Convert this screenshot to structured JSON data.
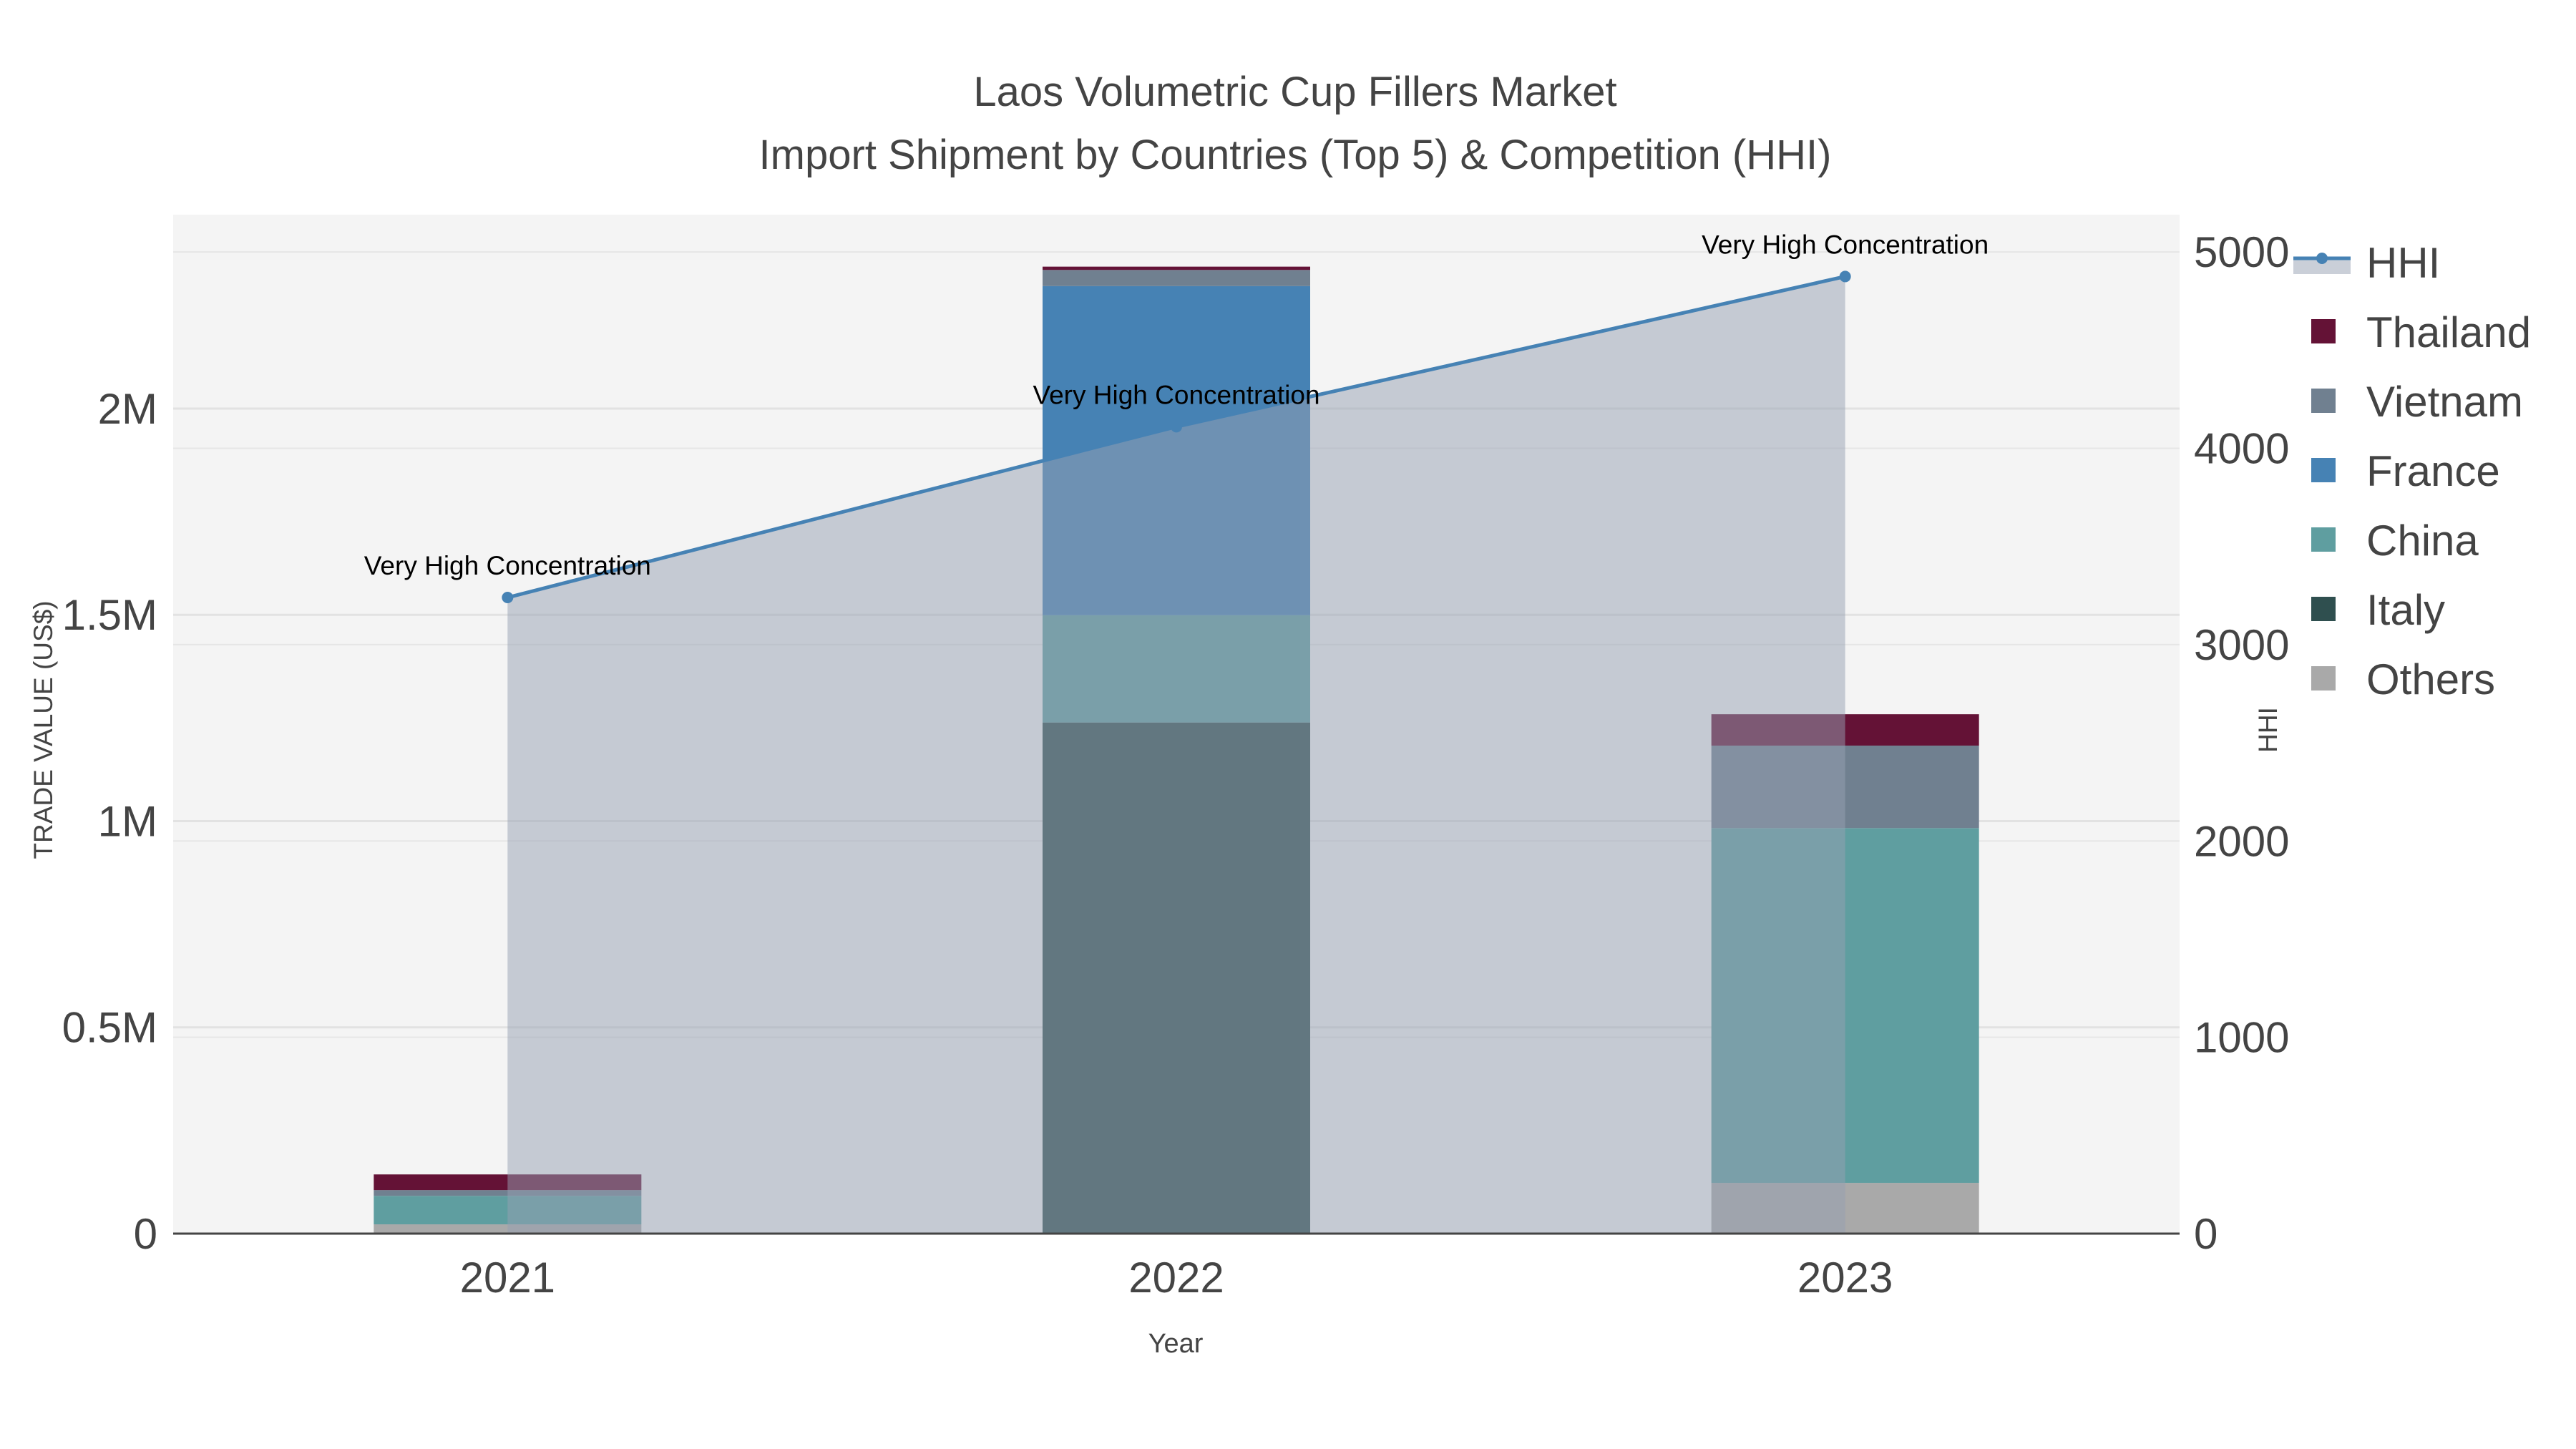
{
  "chart_data": {
    "type": "bar",
    "stacked": true,
    "title": "Laos Volumetric Cup Fillers Market",
    "subtitle": "Import Shipment by Countries (Top 5) & Competition (HHI)",
    "xlabel": "Year",
    "ylabel": "TRADE VALUE (US$)",
    "y2label": "HHI",
    "categories": [
      "2021",
      "2022",
      "2023"
    ],
    "ylim": [
      0,
      2470000
    ],
    "y2lim": [
      0,
      5190
    ],
    "yticks": [
      {
        "value": 0,
        "label": "0"
      },
      {
        "value": 500000,
        "label": "0.5M"
      },
      {
        "value": 1000000,
        "label": "1M"
      },
      {
        "value": 1500000,
        "label": "1.5M"
      },
      {
        "value": 2000000,
        "label": "2M"
      }
    ],
    "y2ticks": [
      {
        "value": 0,
        "label": "0"
      },
      {
        "value": 1000,
        "label": "1000"
      },
      {
        "value": 2000,
        "label": "2000"
      },
      {
        "value": 3000,
        "label": "3000"
      },
      {
        "value": 4000,
        "label": "4000"
      },
      {
        "value": 5000,
        "label": "5000"
      }
    ],
    "grid": true,
    "legend_position": "right",
    "series": [
      {
        "name": "Others",
        "color": "#a9a9a9",
        "values": [
          22500,
          0,
          123000
        ]
      },
      {
        "name": "Italy",
        "color": "#2f4f4f",
        "values": [
          0,
          1239000,
          0
        ]
      },
      {
        "name": "China",
        "color": "#5f9ea0",
        "values": [
          69000,
          260000,
          860000
        ]
      },
      {
        "name": "France",
        "color": "#4682b4",
        "values": [
          0,
          798000,
          0
        ]
      },
      {
        "name": "Vietnam",
        "color": "#708090",
        "values": [
          14000,
          39000,
          200000
        ]
      },
      {
        "name": "Thailand",
        "color": "#641236",
        "values": [
          38000,
          8000,
          76000
        ]
      }
    ],
    "hhi": {
      "name": "HHI",
      "color": "#4682b4",
      "fill": "rgba(150,160,178,0.5)",
      "values": [
        3240,
        4110,
        4875
      ],
      "annotations": [
        "Very High Concentration",
        "Very High Concentration",
        "Very High Concentration"
      ]
    },
    "legend": [
      "HHI",
      "Thailand",
      "Vietnam",
      "France",
      "China",
      "Italy",
      "Others"
    ]
  }
}
